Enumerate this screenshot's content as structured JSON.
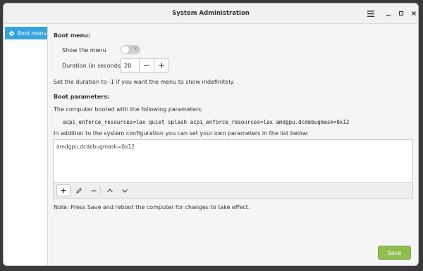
{
  "window": {
    "title": "System Administration"
  },
  "sidebar": {
    "items": [
      {
        "label": "Boot menu",
        "icon": "boot-icon"
      }
    ]
  },
  "boot_menu": {
    "heading": "Boot menu:",
    "show_menu_label": "Show the menu",
    "show_menu_state": "off",
    "duration_label": "Duration (in seconds)",
    "duration_value": "20",
    "decrement": "−",
    "increment": "+",
    "hint": "Set the duration to -1 if you want the menu to show indefinitely."
  },
  "boot_params": {
    "heading": "Boot parameters:",
    "booted_with_label": "The computer booted with the following parameters:",
    "current_params": "acpi_enforce_resources=lax quiet splash acpi_enforce_resources=lax amdgpu.dcdebugmask=0x12",
    "list_intro": "In addition to the system configuration you can set your own parameters in the list below:",
    "list_items": [
      "amdgpu.dcdebugmask=0x12"
    ],
    "note": "Note: Press Save and reboot the computer for changes to take effect."
  },
  "actions": {
    "save_label": "Save"
  },
  "colors": {
    "accent": "#35a5e0",
    "save": "#8fbe4f"
  }
}
